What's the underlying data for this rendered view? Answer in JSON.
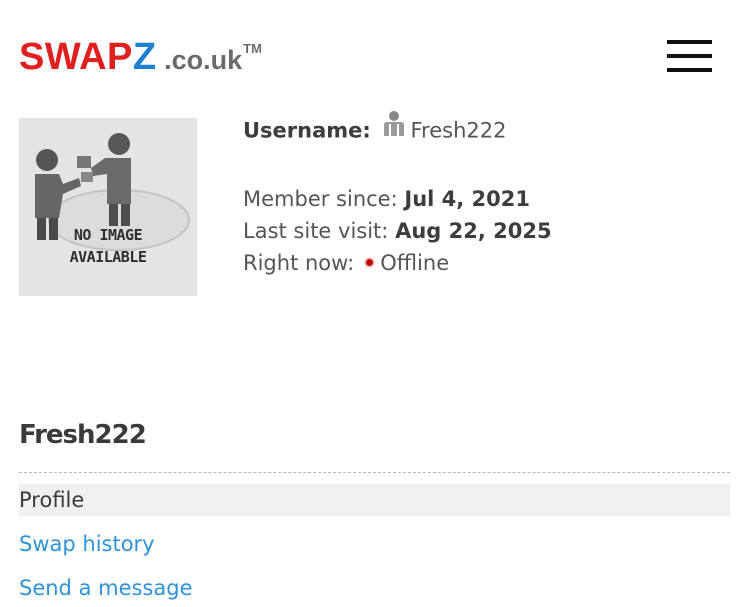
{
  "header": {
    "logo_swap": "SWAP",
    "logo_z": "Z",
    "logo_domain": ".co.uk",
    "logo_tm": "TM",
    "menu_icon": "hamburger-menu-icon"
  },
  "avatar": {
    "line1": "NO IMAGE",
    "line2": "AVAILABLE"
  },
  "profile": {
    "username_label": "Username:",
    "username": "Fresh222",
    "member_since_label": "Member since:",
    "member_since": "Jul 4, 2021",
    "last_visit_label": "Last site visit:",
    "last_visit": "Aug 22, 2025",
    "right_now_label": "Right now:",
    "status": "Offline",
    "status_color": "#c00000"
  },
  "section": {
    "title": "Fresh222"
  },
  "nav": {
    "items": [
      {
        "label": "Profile"
      },
      {
        "label": "Swap history"
      },
      {
        "label": "Send a message"
      }
    ]
  },
  "colors": {
    "brand_red": "#e0201e",
    "brand_blue": "#1f7fd0",
    "link": "#2e93dc"
  }
}
